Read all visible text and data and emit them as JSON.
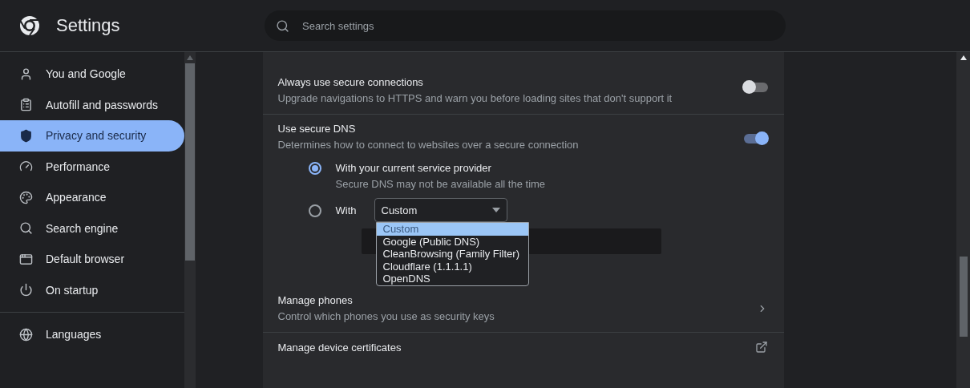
{
  "header": {
    "title": "Settings",
    "search": {
      "placeholder": "Search settings"
    }
  },
  "sidebar": {
    "groups": [
      {
        "items": [
          {
            "label": "You and Google",
            "selected": false
          },
          {
            "label": "Autofill and passwords",
            "selected": false
          },
          {
            "label": "Privacy and security",
            "selected": true
          },
          {
            "label": "Performance",
            "selected": false
          },
          {
            "label": "Appearance",
            "selected": false
          },
          {
            "label": "Search engine",
            "selected": false
          },
          {
            "label": "Default browser",
            "selected": false
          },
          {
            "label": "On startup",
            "selected": false
          }
        ]
      },
      {
        "items": [
          {
            "label": "Languages",
            "selected": false
          }
        ]
      }
    ]
  },
  "settings": [
    {
      "kind": "toggle",
      "title": "Always use secure connections",
      "description": "Upgrade navigations to HTTPS and warn you before loading sites that don't support it",
      "on": false
    },
    {
      "kind": "dns",
      "title": "Use secure DNS",
      "description": "Determines how to connect to websites over a secure connection",
      "on": true,
      "options": [
        {
          "label": "With your current service provider",
          "description": "Secure DNS may not be available all the time",
          "selected": true
        },
        {
          "label": "With",
          "selected": false
        }
      ],
      "provider": {
        "value": "Custom",
        "expanded": true,
        "options": [
          {
            "label": "Custom",
            "selected": true
          },
          {
            "label": "Google (Public DNS)",
            "selected": false
          },
          {
            "label": "CleanBrowsing (Family Filter)",
            "selected": false
          },
          {
            "label": "Cloudflare (1.1.1.1)",
            "selected": false
          },
          {
            "label": "OpenDNS",
            "selected": false
          }
        ]
      }
    },
    {
      "kind": "link",
      "title": "Manage phones",
      "description": "Control which phones you use as security keys"
    },
    {
      "kind": "external",
      "title": "Manage device certificates"
    }
  ]
}
